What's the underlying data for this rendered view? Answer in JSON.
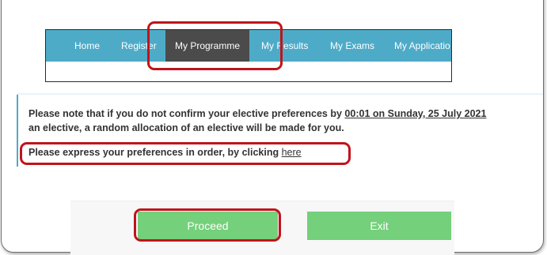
{
  "nav": {
    "items": [
      {
        "label": "Home"
      },
      {
        "label": "Register"
      },
      {
        "label": "My Programme"
      },
      {
        "label": "My Results"
      },
      {
        "label": "My Exams"
      },
      {
        "label": "My Applicatio"
      }
    ]
  },
  "notice": {
    "line1_prefix": "Please note that if you do not confirm your elective preferences by ",
    "deadline": "00:01 on Sunday, 25 July 2021",
    "line2": "an elective, a random allocation of an elective will be made for you."
  },
  "express": {
    "text": "Please express your preferences in order, by clicking ",
    "link": "here"
  },
  "buttons": {
    "proceed": "Proceed",
    "exit": "Exit"
  },
  "colors": {
    "nav_bg": "#4eabc8",
    "nav_active": "#4b4b4b",
    "button_green": "#74d07a",
    "highlight_red": "#c0141b"
  }
}
